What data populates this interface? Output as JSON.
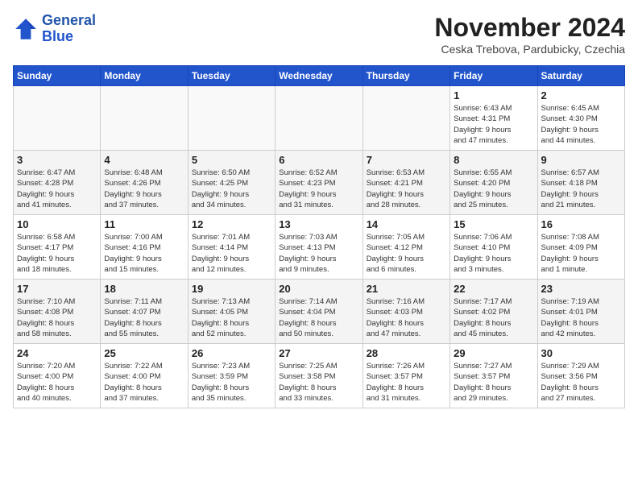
{
  "header": {
    "logo_line1": "General",
    "logo_line2": "Blue",
    "month": "November 2024",
    "location": "Ceska Trebova, Pardubicky, Czechia"
  },
  "weekdays": [
    "Sunday",
    "Monday",
    "Tuesday",
    "Wednesday",
    "Thursday",
    "Friday",
    "Saturday"
  ],
  "rows": [
    [
      {
        "day": "",
        "info": ""
      },
      {
        "day": "",
        "info": ""
      },
      {
        "day": "",
        "info": ""
      },
      {
        "day": "",
        "info": ""
      },
      {
        "day": "",
        "info": ""
      },
      {
        "day": "1",
        "info": "Sunrise: 6:43 AM\nSunset: 4:31 PM\nDaylight: 9 hours\nand 47 minutes."
      },
      {
        "day": "2",
        "info": "Sunrise: 6:45 AM\nSunset: 4:30 PM\nDaylight: 9 hours\nand 44 minutes."
      }
    ],
    [
      {
        "day": "3",
        "info": "Sunrise: 6:47 AM\nSunset: 4:28 PM\nDaylight: 9 hours\nand 41 minutes."
      },
      {
        "day": "4",
        "info": "Sunrise: 6:48 AM\nSunset: 4:26 PM\nDaylight: 9 hours\nand 37 minutes."
      },
      {
        "day": "5",
        "info": "Sunrise: 6:50 AM\nSunset: 4:25 PM\nDaylight: 9 hours\nand 34 minutes."
      },
      {
        "day": "6",
        "info": "Sunrise: 6:52 AM\nSunset: 4:23 PM\nDaylight: 9 hours\nand 31 minutes."
      },
      {
        "day": "7",
        "info": "Sunrise: 6:53 AM\nSunset: 4:21 PM\nDaylight: 9 hours\nand 28 minutes."
      },
      {
        "day": "8",
        "info": "Sunrise: 6:55 AM\nSunset: 4:20 PM\nDaylight: 9 hours\nand 25 minutes."
      },
      {
        "day": "9",
        "info": "Sunrise: 6:57 AM\nSunset: 4:18 PM\nDaylight: 9 hours\nand 21 minutes."
      }
    ],
    [
      {
        "day": "10",
        "info": "Sunrise: 6:58 AM\nSunset: 4:17 PM\nDaylight: 9 hours\nand 18 minutes."
      },
      {
        "day": "11",
        "info": "Sunrise: 7:00 AM\nSunset: 4:16 PM\nDaylight: 9 hours\nand 15 minutes."
      },
      {
        "day": "12",
        "info": "Sunrise: 7:01 AM\nSunset: 4:14 PM\nDaylight: 9 hours\nand 12 minutes."
      },
      {
        "day": "13",
        "info": "Sunrise: 7:03 AM\nSunset: 4:13 PM\nDaylight: 9 hours\nand 9 minutes."
      },
      {
        "day": "14",
        "info": "Sunrise: 7:05 AM\nSunset: 4:12 PM\nDaylight: 9 hours\nand 6 minutes."
      },
      {
        "day": "15",
        "info": "Sunrise: 7:06 AM\nSunset: 4:10 PM\nDaylight: 9 hours\nand 3 minutes."
      },
      {
        "day": "16",
        "info": "Sunrise: 7:08 AM\nSunset: 4:09 PM\nDaylight: 9 hours\nand 1 minute."
      }
    ],
    [
      {
        "day": "17",
        "info": "Sunrise: 7:10 AM\nSunset: 4:08 PM\nDaylight: 8 hours\nand 58 minutes."
      },
      {
        "day": "18",
        "info": "Sunrise: 7:11 AM\nSunset: 4:07 PM\nDaylight: 8 hours\nand 55 minutes."
      },
      {
        "day": "19",
        "info": "Sunrise: 7:13 AM\nSunset: 4:05 PM\nDaylight: 8 hours\nand 52 minutes."
      },
      {
        "day": "20",
        "info": "Sunrise: 7:14 AM\nSunset: 4:04 PM\nDaylight: 8 hours\nand 50 minutes."
      },
      {
        "day": "21",
        "info": "Sunrise: 7:16 AM\nSunset: 4:03 PM\nDaylight: 8 hours\nand 47 minutes."
      },
      {
        "day": "22",
        "info": "Sunrise: 7:17 AM\nSunset: 4:02 PM\nDaylight: 8 hours\nand 45 minutes."
      },
      {
        "day": "23",
        "info": "Sunrise: 7:19 AM\nSunset: 4:01 PM\nDaylight: 8 hours\nand 42 minutes."
      }
    ],
    [
      {
        "day": "24",
        "info": "Sunrise: 7:20 AM\nSunset: 4:00 PM\nDaylight: 8 hours\nand 40 minutes."
      },
      {
        "day": "25",
        "info": "Sunrise: 7:22 AM\nSunset: 4:00 PM\nDaylight: 8 hours\nand 37 minutes."
      },
      {
        "day": "26",
        "info": "Sunrise: 7:23 AM\nSunset: 3:59 PM\nDaylight: 8 hours\nand 35 minutes."
      },
      {
        "day": "27",
        "info": "Sunrise: 7:25 AM\nSunset: 3:58 PM\nDaylight: 8 hours\nand 33 minutes."
      },
      {
        "day": "28",
        "info": "Sunrise: 7:26 AM\nSunset: 3:57 PM\nDaylight: 8 hours\nand 31 minutes."
      },
      {
        "day": "29",
        "info": "Sunrise: 7:27 AM\nSunset: 3:57 PM\nDaylight: 8 hours\nand 29 minutes."
      },
      {
        "day": "30",
        "info": "Sunrise: 7:29 AM\nSunset: 3:56 PM\nDaylight: 8 hours\nand 27 minutes."
      }
    ]
  ]
}
